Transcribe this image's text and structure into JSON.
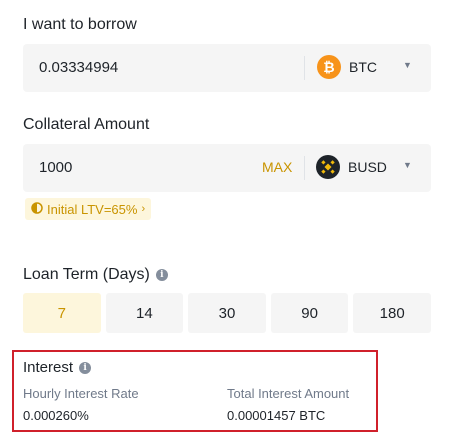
{
  "borrow": {
    "label": "I want to borrow",
    "amount": "0.03334994",
    "coin": "BTC"
  },
  "collateral": {
    "label": "Collateral Amount",
    "amount": "1000",
    "max_label": "MAX",
    "coin": "BUSD",
    "ltv_text": "Initial LTV=65%"
  },
  "loan_term": {
    "label": "Loan Term (Days)",
    "options": [
      "7",
      "14",
      "30",
      "90",
      "180"
    ],
    "selected": "7"
  },
  "interest": {
    "title": "Interest",
    "hourly_label": "Hourly Interest Rate",
    "hourly_value": "0.000260%",
    "total_label": "Total Interest Amount",
    "total_value": "0.00001457 BTC"
  },
  "colors": {
    "accent": "#c99400",
    "btc": "#f7931a",
    "busd": "#1e2329",
    "highlight_border": "#d0202b"
  },
  "icons": {
    "btc": "bitcoin-icon",
    "busd": "busd-icon",
    "ltv": "half-circle-gauge-icon",
    "info": "info-icon",
    "caret": "caret-down-icon"
  }
}
